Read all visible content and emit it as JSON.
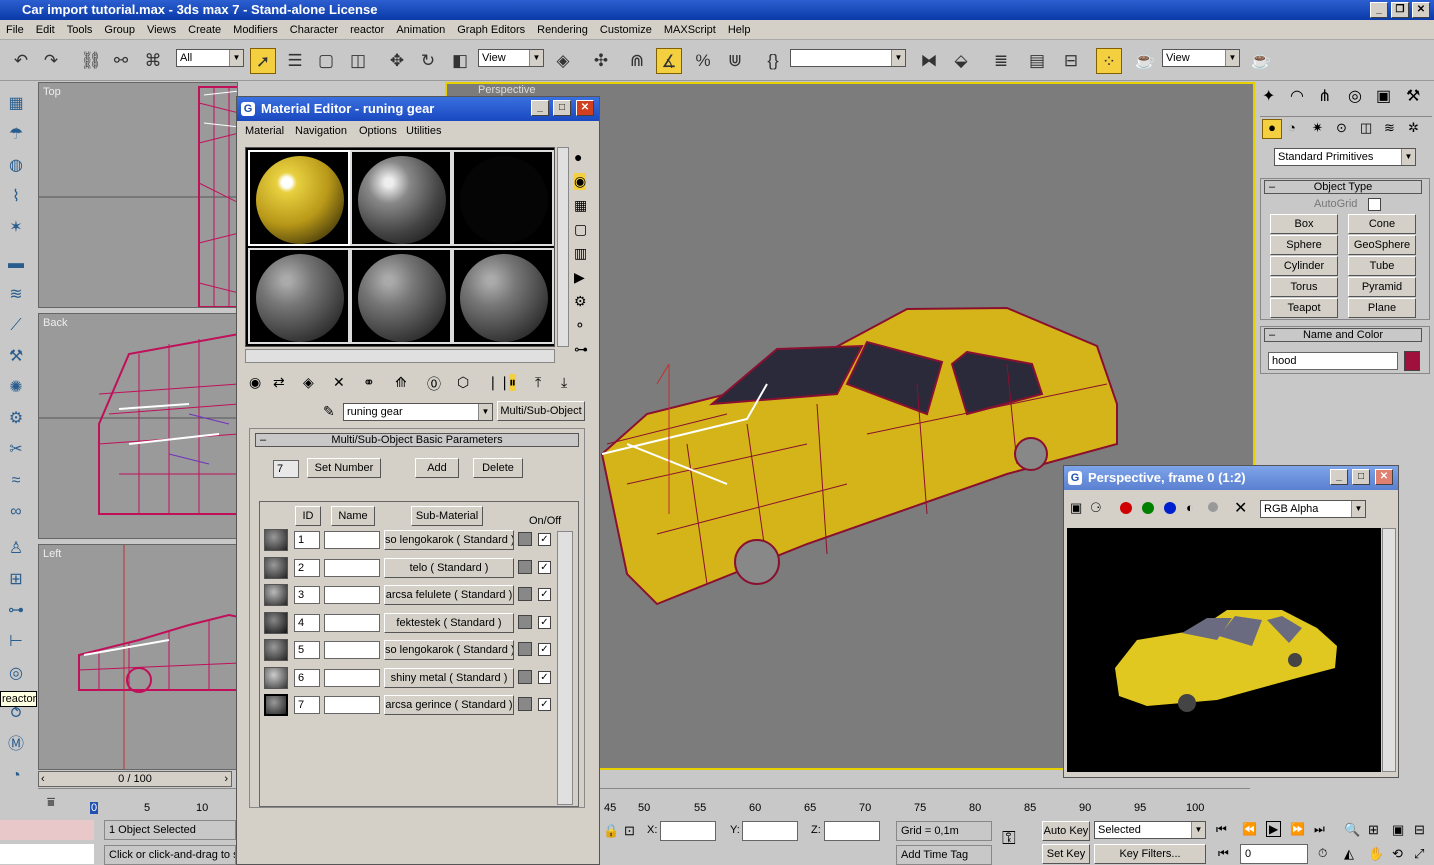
{
  "app": {
    "title": "Car import tutorial.max - 3ds max 7  - Stand-alone License",
    "min": "_",
    "max": "❐",
    "close": "✕"
  },
  "menu": [
    "File",
    "Edit",
    "Tools",
    "Group",
    "Views",
    "Create",
    "Modifiers",
    "Character",
    "reactor",
    "Animation",
    "Graph Editors",
    "Rendering",
    "Customize",
    "MAXScript",
    "Help"
  ],
  "toolbar": {
    "selection_filter": "All",
    "ref_coord": "View",
    "ref_coord2": "View",
    "named_sel": ""
  },
  "viewports": {
    "top": "Top",
    "back": "Back",
    "left": "Left",
    "perspective": "Perspective"
  },
  "tooltip": "reactor",
  "material_editor": {
    "title": "Material Editor - runing gear",
    "menu": [
      "Material",
      "Navigation",
      "Options",
      "Utilities"
    ],
    "material_name": "runing gear",
    "type_button": "Multi/Sub-Object",
    "rollout_title": "Multi/Sub-Object Basic Parameters",
    "count": "7",
    "set_number": "Set Number",
    "add": "Add",
    "delete": "Delete",
    "headers": {
      "id": "ID",
      "name": "Name",
      "sub": "Sub-Material",
      "onoff": "On/Off"
    },
    "rows": [
      {
        "id": "1",
        "sub": "so lengokarok  ( Standard )"
      },
      {
        "id": "2",
        "sub": "telo  ( Standard )"
      },
      {
        "id": "3",
        "sub": "arcsa felulete  ( Standard )"
      },
      {
        "id": "4",
        "sub": "fektestek  ( Standard )"
      },
      {
        "id": "5",
        "sub": "so lengokarok  ( Standard )"
      },
      {
        "id": "6",
        "sub": "shiny metal  ( Standard )"
      },
      {
        "id": "7",
        "sub": "arcsa gerince  ( Standard )"
      }
    ]
  },
  "command_panel": {
    "category": "Standard Primitives",
    "object_type": "Object Type",
    "autogrid": "AutoGrid",
    "buttons": [
      "Box",
      "Cone",
      "Sphere",
      "GeoSphere",
      "Cylinder",
      "Tube",
      "Torus",
      "Pyramid",
      "Teapot",
      "Plane"
    ],
    "name_color": "Name and Color",
    "object_name": "hood",
    "object_color": "#a0103c"
  },
  "render_window": {
    "title": "Perspective, frame 0 (1:2)",
    "channel": "RGB Alpha"
  },
  "timeline": {
    "frame": "0 / 100",
    "ticks": [
      "0",
      "5",
      "10",
      "45",
      "50",
      "55",
      "60",
      "65",
      "70",
      "75",
      "80",
      "85",
      "90",
      "95",
      "100"
    ]
  },
  "status": {
    "selected": "1 Object Selected",
    "prompt": "Click or click-and-drag to s",
    "x_label": "X:",
    "y_label": "Y:",
    "z_label": "Z:",
    "grid": "Grid = 0,1m",
    "add_time_tag": "Add Time Tag",
    "auto_key": "Auto Key",
    "set_key": "Set Key",
    "key_mode": "Selected",
    "key_filters": "Key Filters...",
    "current_frame": "0"
  }
}
